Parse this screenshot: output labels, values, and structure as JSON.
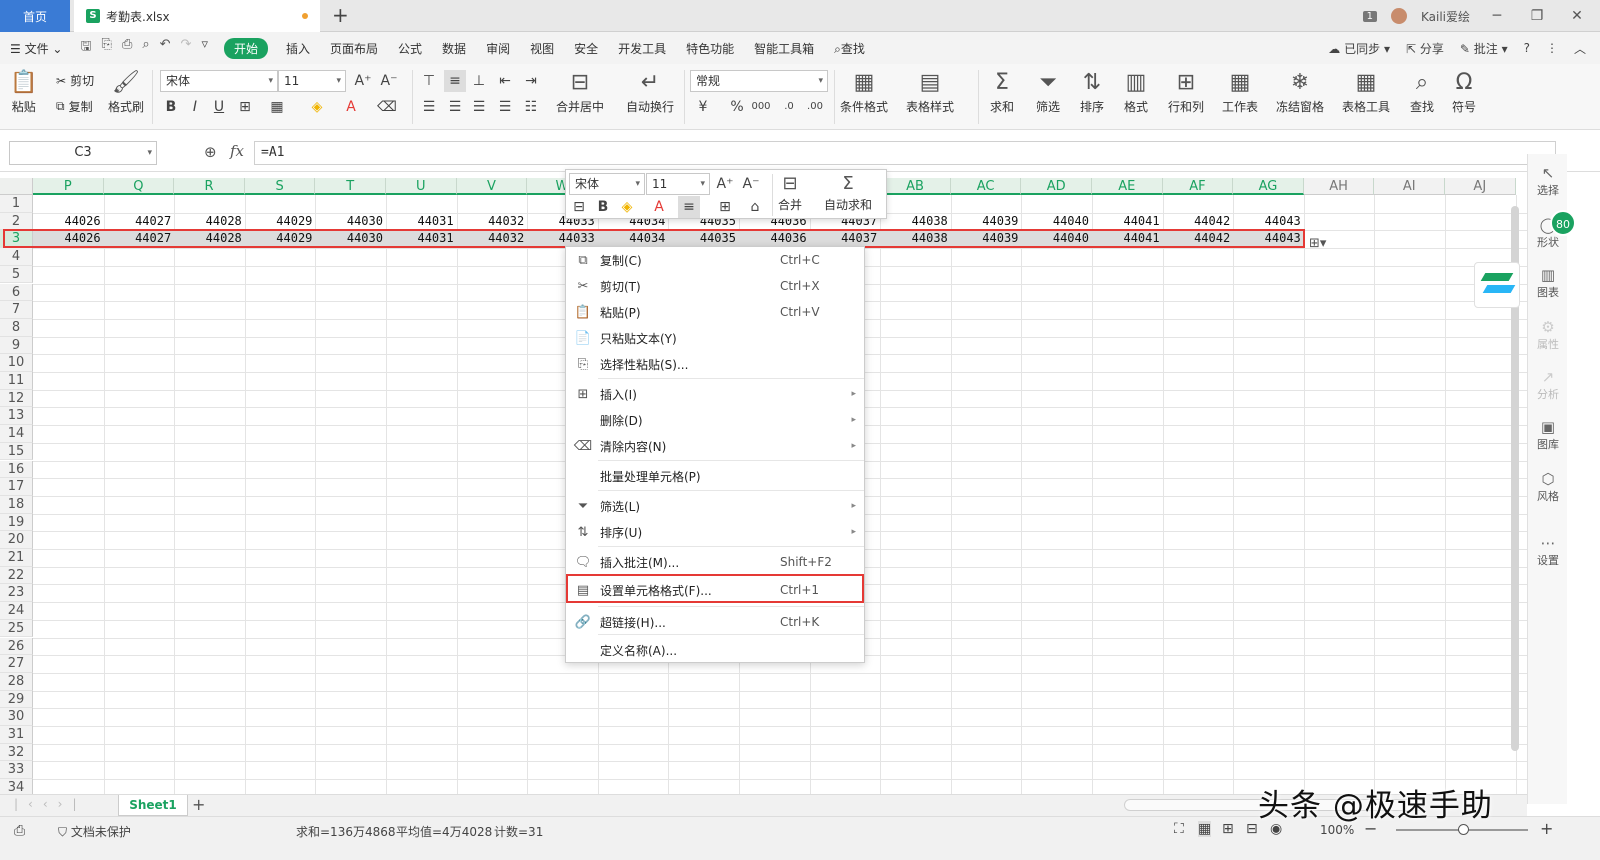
{
  "titlebar": {
    "home_tab": "首页",
    "file_tab": "考勤表.xlsx",
    "file_icon": "S",
    "badge": "1",
    "user": "Kaili爱绘"
  },
  "menubar": {
    "file": "文件",
    "tabs": [
      "开始",
      "插入",
      "页面布局",
      "公式",
      "数据",
      "审阅",
      "视图",
      "安全",
      "开发工具",
      "特色功能",
      "智能工具箱"
    ],
    "search": "查找",
    "sync": "已同步",
    "share": "分享",
    "comment": "批注"
  },
  "ribbon": {
    "paste": "粘贴",
    "cut": "剪切",
    "copy": "复制",
    "format_painter": "格式刷",
    "font_name": "宋体",
    "font_size": "11",
    "merge_center": "合并居中",
    "wrap": "自动换行",
    "number_format": "常规",
    "conditional": "条件格式",
    "table_style": "表格样式",
    "sum": "求和",
    "filter": "筛选",
    "sort": "排序",
    "format": "格式",
    "rowcol": "行和列",
    "sheet": "工作表",
    "freeze": "冻结窗格",
    "table_tools": "表格工具",
    "find": "查找",
    "symbol": "符号"
  },
  "formula_bar": {
    "name_box": "C3",
    "fx": "fx",
    "formula": "=A1"
  },
  "grid": {
    "columns": [
      "P",
      "Q",
      "R",
      "S",
      "T",
      "U",
      "V",
      "W",
      "X",
      "Y",
      "Z",
      "AA",
      "AB",
      "AC",
      "AD",
      "AE",
      "AF",
      "AG",
      "AH",
      "AI",
      "AJ"
    ],
    "rows": [
      "1",
      "2",
      "3",
      "4",
      "5",
      "6",
      "7",
      "8",
      "9",
      "10",
      "11",
      "12",
      "13",
      "14",
      "15",
      "16",
      "17",
      "18",
      "19",
      "20",
      "21",
      "22",
      "23",
      "24",
      "25",
      "26",
      "27",
      "28",
      "29",
      "30",
      "31",
      "32",
      "33",
      "34"
    ],
    "row2": [
      "44026",
      "44027",
      "44028",
      "44029",
      "44030",
      "44031",
      "44032",
      "44033",
      "44034",
      "44035",
      "44036",
      "44037",
      "44038",
      "44039",
      "44040",
      "44041",
      "44042",
      "44043"
    ],
    "row3": [
      "44026",
      "44027",
      "44028",
      "44029",
      "44030",
      "44031",
      "44032",
      "44033",
      "44034",
      "44035",
      "44036",
      "44037",
      "44038",
      "44039",
      "44040",
      "44041",
      "44042",
      "44043"
    ]
  },
  "mini_toolbar": {
    "font_name": "宋体",
    "font_size": "11",
    "merge": "合并",
    "autosum": "自动求和"
  },
  "context_menu": [
    {
      "label": "复制(C)",
      "shortcut": "Ctrl+C",
      "icon": "copy-icon"
    },
    {
      "label": "剪切(T)",
      "shortcut": "Ctrl+X",
      "icon": "scissors-icon"
    },
    {
      "label": "粘贴(P)",
      "shortcut": "Ctrl+V",
      "icon": "paste-icon"
    },
    {
      "label": "只粘贴文本(Y)",
      "shortcut": "",
      "icon": "paste-text-icon"
    },
    {
      "label": "选择性粘贴(S)...",
      "shortcut": "",
      "icon": "paste-special-icon"
    },
    {
      "label": "插入(I)",
      "shortcut": "",
      "icon": "insert-icon"
    },
    {
      "label": "删除(D)",
      "shortcut": "",
      "icon": ""
    },
    {
      "label": "清除内容(N)",
      "shortcut": "",
      "icon": "eraser-icon"
    },
    {
      "label": "批量处理单元格(P)",
      "shortcut": "",
      "icon": ""
    },
    {
      "label": "筛选(L)",
      "shortcut": "",
      "icon": "filter-icon"
    },
    {
      "label": "排序(U)",
      "shortcut": "",
      "icon": "sort-icon"
    },
    {
      "label": "插入批注(M)...",
      "shortcut": "Shift+F2",
      "icon": "comment-icon"
    },
    {
      "label": "设置单元格格式(F)...",
      "shortcut": "Ctrl+1",
      "icon": "format-cells-icon"
    },
    {
      "label": "超链接(H)...",
      "shortcut": "Ctrl+K",
      "icon": "link-icon"
    },
    {
      "label": "定义名称(A)...",
      "shortcut": "",
      "icon": ""
    }
  ],
  "right_panel": [
    "选择",
    "形状",
    "图表",
    "属性",
    "分析",
    "图库",
    "风格",
    "设置"
  ],
  "right_badge": "80",
  "sheet_tab": "Sheet1",
  "status": {
    "protect": "文档未保护",
    "sum": "求和=136万4868",
    "avg": "平均值=4万4028",
    "count": "计数=31",
    "zoom": "100%"
  },
  "watermark": "头条 @极速手助"
}
